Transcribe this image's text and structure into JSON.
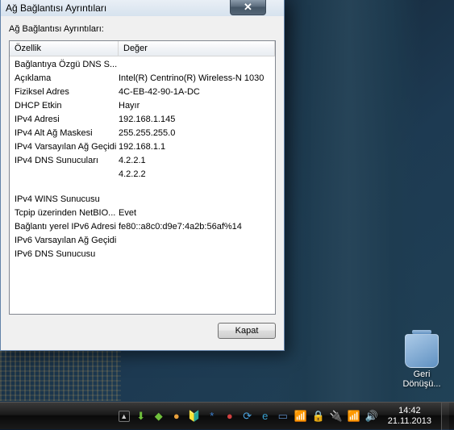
{
  "dialog": {
    "title": "Ağ Bağlantısı Ayrıntıları",
    "subtitle": "Ağ Bağlantısı Ayrıntıları:",
    "columns": {
      "property": "Özellik",
      "value": "Değer"
    },
    "rows": [
      {
        "p": "Bağlantıya Özgü DNS S...",
        "v": ""
      },
      {
        "p": "Açıklama",
        "v": "Intel(R) Centrino(R) Wireless-N 1030"
      },
      {
        "p": "Fiziksel Adres",
        "v": "4C-EB-42-90-1A-DC"
      },
      {
        "p": "DHCP Etkin",
        "v": "Hayır"
      },
      {
        "p": "IPv4 Adresi",
        "v": "192.168.1.145"
      },
      {
        "p": "IPv4 Alt Ağ Maskesi",
        "v": "255.255.255.0"
      },
      {
        "p": "IPv4 Varsayılan Ağ Geçidi",
        "v": "192.168.1.1"
      },
      {
        "p": "IPv4 DNS Sunucuları",
        "v": "4.2.2.1"
      },
      {
        "p": "",
        "v": "4.2.2.2"
      },
      {
        "p": "IPv4 WINS Sunucusu",
        "v": ""
      },
      {
        "p": "Tcpip üzerinden NetBIO...",
        "v": "Evet"
      },
      {
        "p": "Bağlantı yerel IPv6 Adresi",
        "v": "fe80::a8c0:d9e7:4a2b:56af%14"
      },
      {
        "p": "IPv6 Varsayılan Ağ Geçidi",
        "v": ""
      },
      {
        "p": "IPv6 DNS Sunucusu",
        "v": ""
      }
    ],
    "close_button": "Kapat"
  },
  "desktop": {
    "recycle_bin_label": "Geri Dönüşü..."
  },
  "taskbar": {
    "time": "14:42",
    "date": "21.11.2013",
    "tray_icons": [
      {
        "name": "download-manager-icon",
        "color": "#6fbf3c",
        "glyph": "⬇"
      },
      {
        "name": "app-green-icon",
        "color": "#6fbf3c",
        "glyph": "◆"
      },
      {
        "name": "app-orange-icon",
        "color": "#e8a03c",
        "glyph": "●"
      },
      {
        "name": "antivirus-icon",
        "color": "#4aa3e0",
        "glyph": "🔰"
      },
      {
        "name": "bluetooth-icon",
        "color": "#3a7fd0",
        "glyph": "*"
      },
      {
        "name": "app-red-icon",
        "color": "#d04040",
        "glyph": "●"
      },
      {
        "name": "sync-icon",
        "color": "#4aa3e0",
        "glyph": "⟳"
      },
      {
        "name": "browser-e-icon",
        "color": "#3aa0d0",
        "glyph": "e"
      },
      {
        "name": "display-icon",
        "color": "#5a88c0",
        "glyph": "▭"
      },
      {
        "name": "wifi-icon",
        "color": "#5a88c0",
        "glyph": "📶"
      },
      {
        "name": "lock-icon",
        "color": "#e0b040",
        "glyph": "🔒"
      },
      {
        "name": "power-icon",
        "color": "#aaa",
        "glyph": "🔌"
      },
      {
        "name": "network-icon",
        "color": "#ddd",
        "glyph": "📶"
      },
      {
        "name": "volume-icon",
        "color": "#ddd",
        "glyph": "🔊"
      }
    ]
  }
}
